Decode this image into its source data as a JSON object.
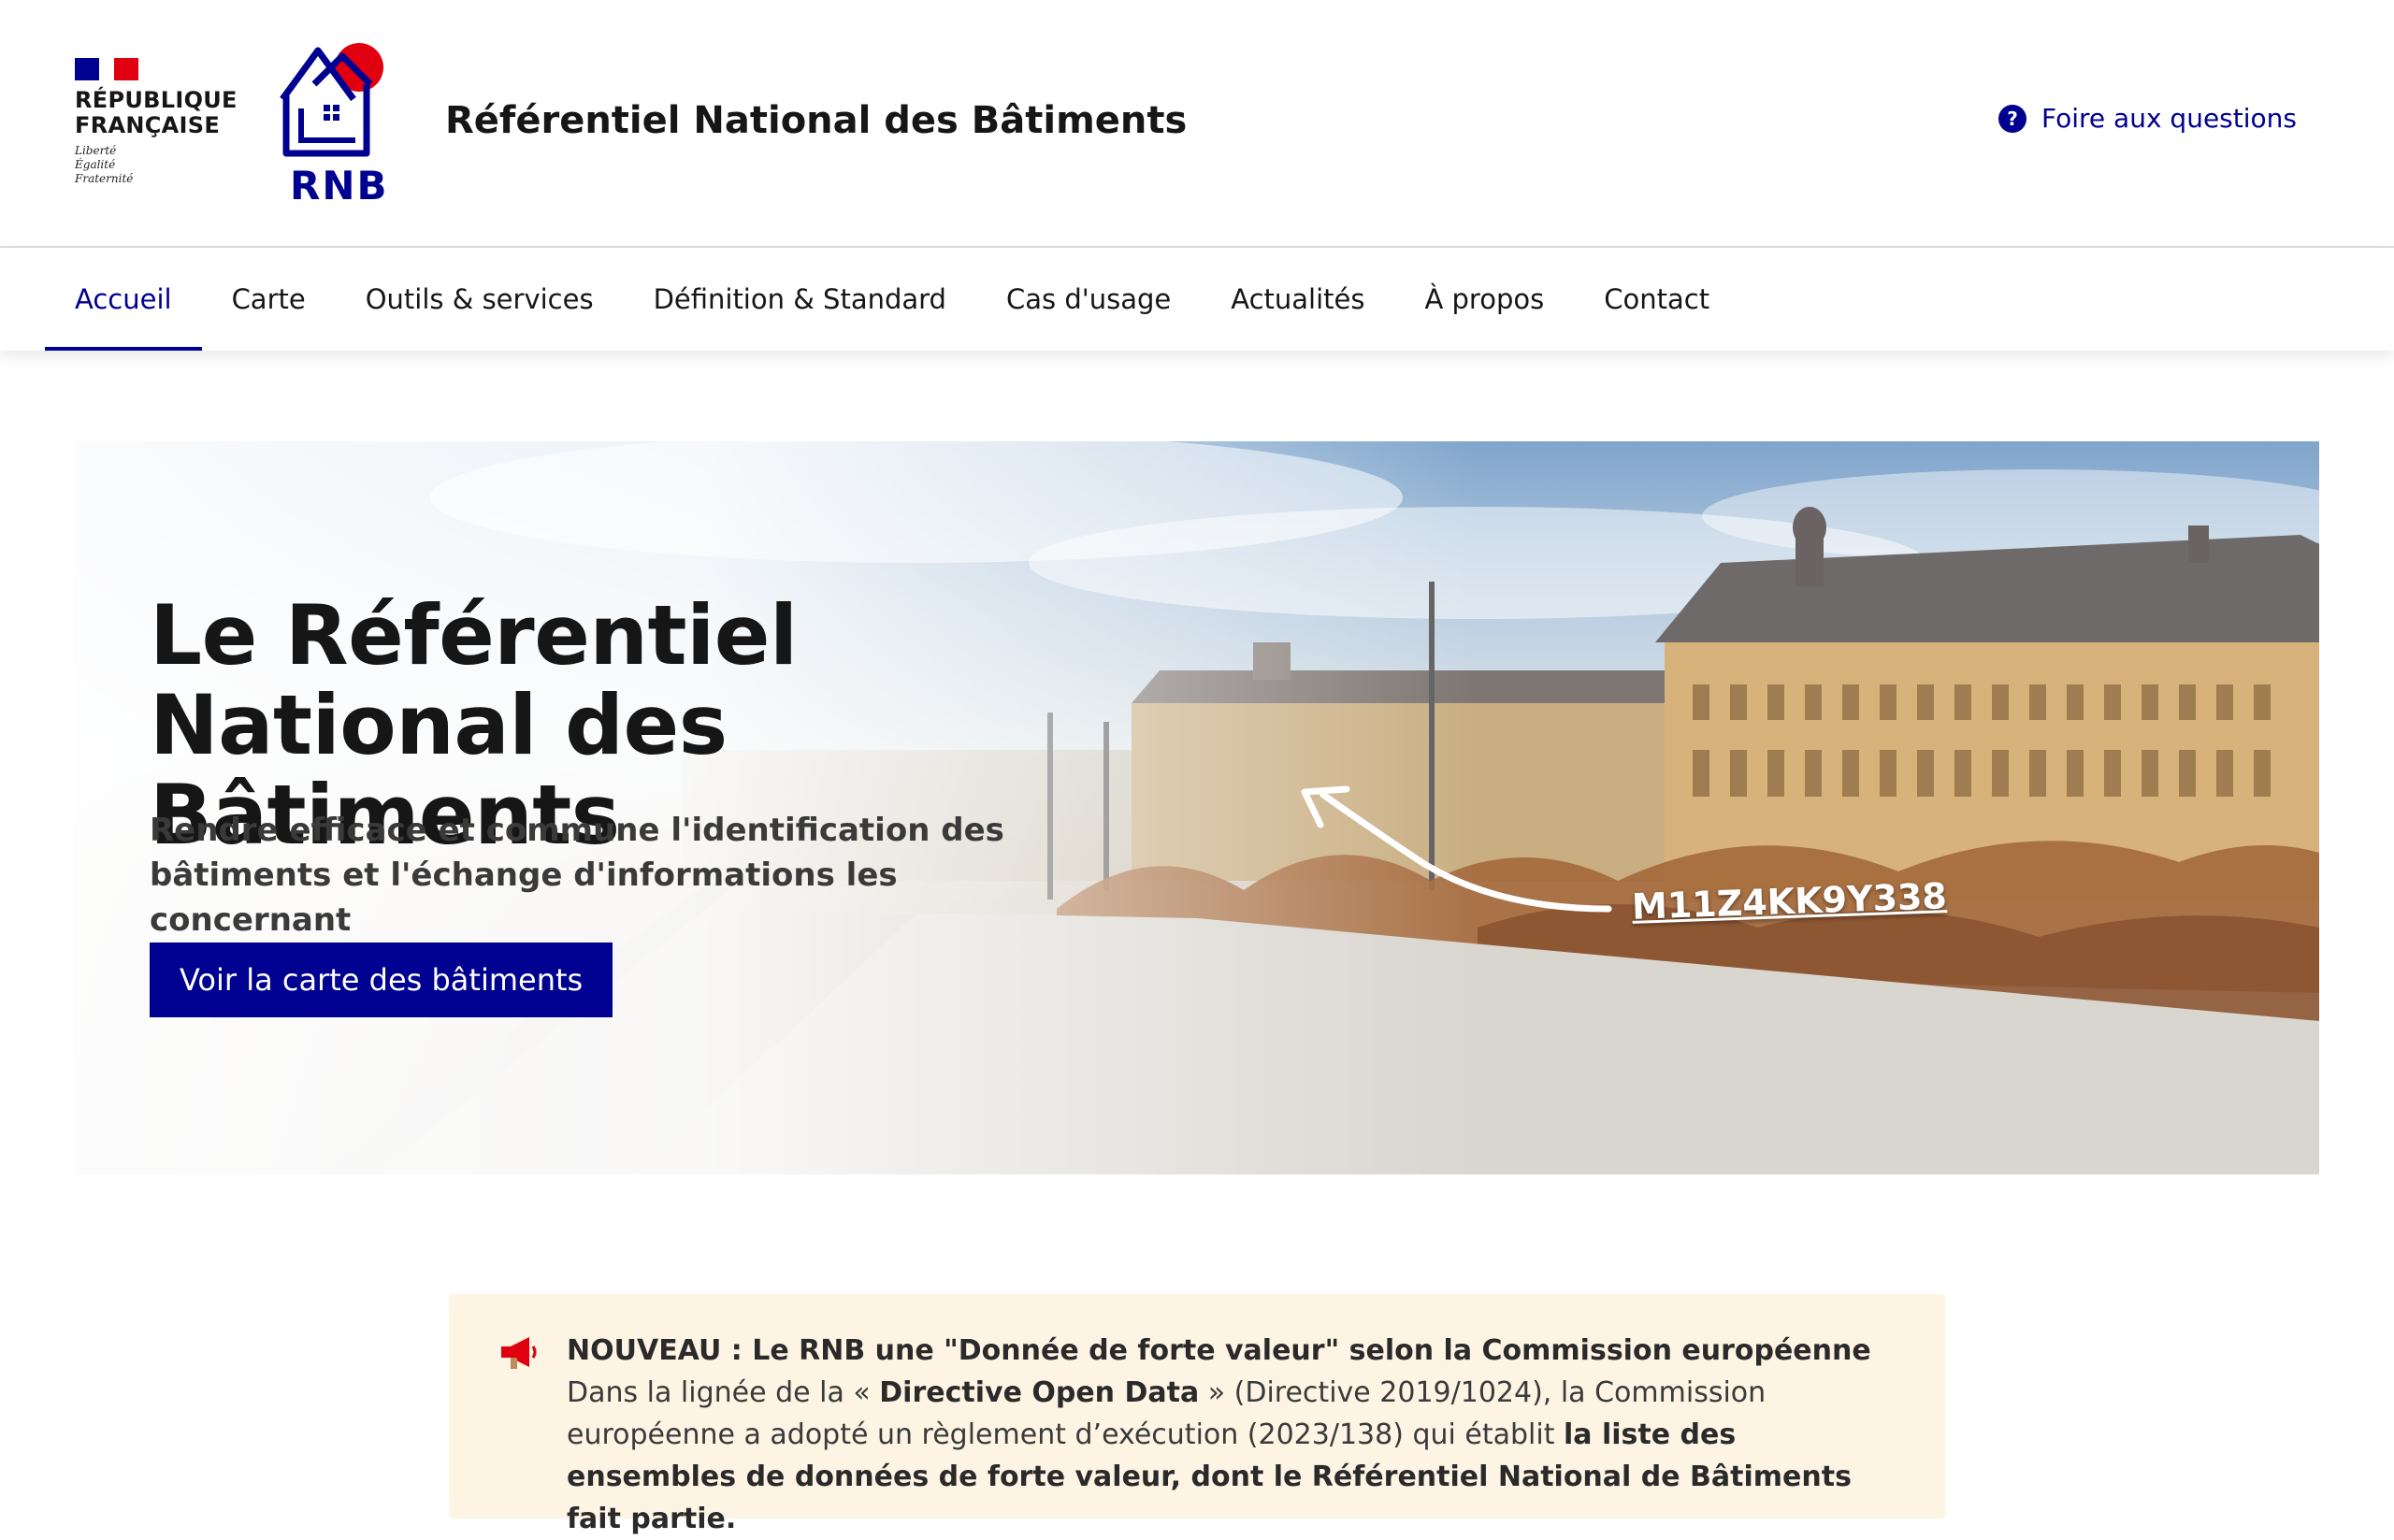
{
  "header": {
    "republique_name": "République\nFrançaise",
    "motto": "Liberté\nÉgalité\nFraternité",
    "rnb_logo_text": "RNB",
    "site_title": "Référentiel National des Bâtiments",
    "faq_label": "Foire aux questions"
  },
  "nav": {
    "items": [
      {
        "label": "Accueil",
        "active": true
      },
      {
        "label": "Carte"
      },
      {
        "label": "Outils & services"
      },
      {
        "label": "Définition & Standard"
      },
      {
        "label": "Cas d'usage"
      },
      {
        "label": "Actualités"
      },
      {
        "label": "À propos"
      },
      {
        "label": "Contact"
      }
    ]
  },
  "hero": {
    "title": "Le Référentiel National des Bâtiments",
    "subtitle": "Rendre efficace et commune l'identification des bâtiments et l'échange d'informations les concernant",
    "cta_label": "Voir la carte des bâtiments",
    "building_id": "M11Z4KK9Y338"
  },
  "notice": {
    "heading": "NOUVEAU : Le RNB une \"Donnée de forte valeur\" selon la Commission européenne",
    "text_1": "Dans la lignée de la « ",
    "bold_1": "Directive Open Data",
    "text_2": " » (Directive 2019/1024), la Commission européenne a adopté un règlement d’exécution (2023/138) qui établit ",
    "bold_2": "la liste des ensembles de données de forte valeur, dont le Référentiel National de Bâtiments fait partie."
  },
  "colors": {
    "primary": "#000091",
    "accent_red": "#e1000f",
    "notice_bg": "#fef4e4"
  }
}
